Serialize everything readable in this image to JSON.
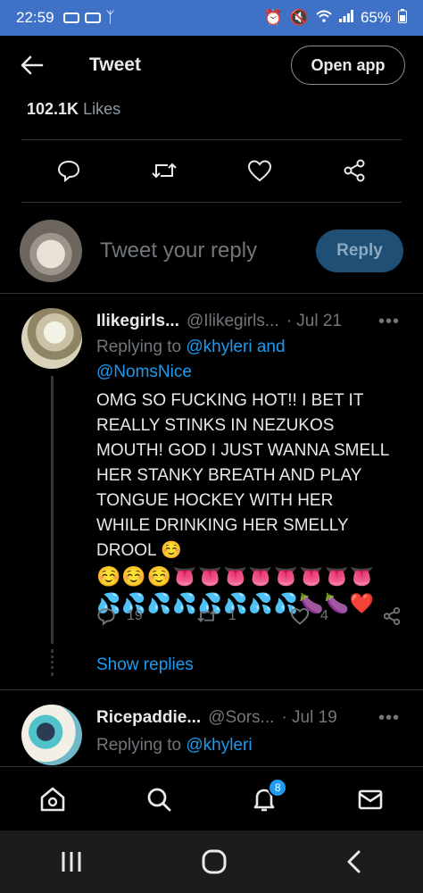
{
  "status_bar": {
    "time": "22:59",
    "battery": "65%"
  },
  "header": {
    "title": "Tweet",
    "open_app": "Open app"
  },
  "likes": {
    "count": "102.1K",
    "label": "Likes"
  },
  "reply_composer": {
    "placeholder": "Tweet your reply",
    "reply_label": "Reply"
  },
  "tweets": [
    {
      "name": "Ilikegirls...",
      "handle": "@Ilikegirls...",
      "date": "· Jul 21",
      "replying_prefix": "Replying to",
      "mention1": "@khyleri",
      "and": "and",
      "mention2": "@NomsNice",
      "text": "OMG SO FUCKING HOT!! I BET IT REALLY STINKS IN NEZUKOS MOUTH! GOD I JUST WANNA SMELL HER STANKY BREATH AND PLAY TONGUE HOCKEY WITH HER WHILE DRINKING HER SMELLY DROOL ☺️",
      "emoji_line1": "☺️☺️☺️👅👅👅👅👅👅👅👅",
      "emoji_line2": "💦💦💦💦💦💦💦💦🍆🍆❤️",
      "replies": "19",
      "retweets": "1",
      "likes": "4",
      "show_replies": "Show replies"
    },
    {
      "name": "Ricepaddie...",
      "handle": "@Sors...",
      "date": "· Jul 19",
      "replying_prefix": "Replying to",
      "mention1": "@khyleri"
    }
  ],
  "nav": {
    "notifications_badge": "8"
  },
  "colors": {
    "status_bar": "#3f72c6",
    "accent": "#1d9bf0",
    "reply_button": "#1f4f75",
    "muted_text": "#71767b"
  }
}
